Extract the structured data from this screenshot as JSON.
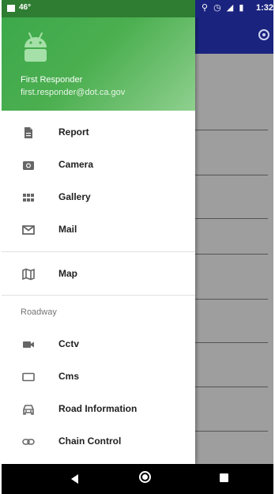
{
  "status_bar": {
    "temperature": "46°",
    "time": "1:32",
    "icons": [
      "location-icon",
      "alarm-icon",
      "signal-icon",
      "battery-icon"
    ]
  },
  "user": {
    "name": "First Responder",
    "email": "first.responder@dot.ca.gov"
  },
  "menu": {
    "primary": [
      {
        "label": "Report",
        "icon": "document-icon"
      },
      {
        "label": "Camera",
        "icon": "camera-icon"
      },
      {
        "label": "Gallery",
        "icon": "gallery-grid-icon"
      },
      {
        "label": "Mail",
        "icon": "mail-icon"
      }
    ],
    "map": {
      "label": "Map",
      "icon": "map-icon"
    },
    "roadway_title": "Roadway",
    "roadway": [
      {
        "label": "Cctv",
        "icon": "video-camera-icon"
      },
      {
        "label": "Cms",
        "icon": "sign-board-icon"
      },
      {
        "label": "Road Information",
        "icon": "car-icon"
      },
      {
        "label": "Chain Control",
        "icon": "chain-link-icon"
      }
    ]
  },
  "colors": {
    "header_green": "#4caf50",
    "toolbar_indigo": "#1a237e",
    "scrim": "#9e9e9e"
  }
}
